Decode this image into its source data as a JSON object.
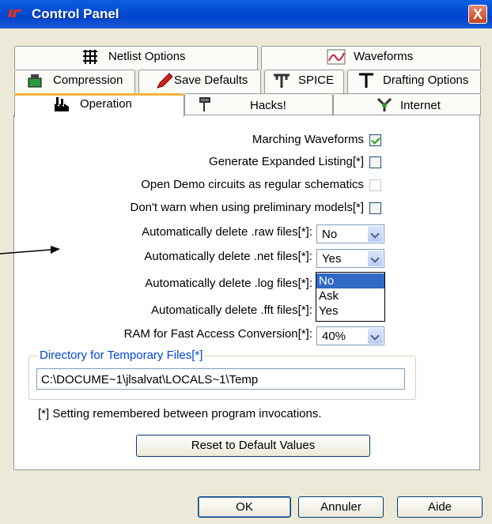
{
  "window": {
    "title": "Control Panel",
    "close": "X"
  },
  "tabs": {
    "row1": [
      {
        "label": "Netlist Options",
        "icon": "grid-icon"
      },
      {
        "label": "Waveforms",
        "icon": "waveform-icon"
      }
    ],
    "row2": [
      {
        "label": "Compression",
        "icon": "compression-icon"
      },
      {
        "label": "Save Defaults",
        "icon": "pencil-icon"
      },
      {
        "label": "SPICE",
        "icon": "spice-icon"
      },
      {
        "label": "Drafting Options",
        "icon": "drafting-icon"
      }
    ],
    "row3": [
      {
        "label": "Operation",
        "icon": "factory-icon",
        "active": true
      },
      {
        "label": "Hacks!",
        "icon": "hammer-icon"
      },
      {
        "label": "Internet",
        "icon": "network-icon"
      }
    ]
  },
  "options": {
    "checkboxes": [
      {
        "label": "Marching Waveforms",
        "checked": true
      },
      {
        "label": "Generate Expanded Listing[*]",
        "checked": false
      },
      {
        "label": "Open Demo circuits as regular schematics",
        "checked": false,
        "disabled": true
      },
      {
        "label": "Don't warn when using preliminary models[*]",
        "checked": false
      }
    ],
    "selects": [
      {
        "label": "Automatically delete .raw files[*]:",
        "value": "No"
      },
      {
        "label": "Automatically delete .net files[*]:",
        "value": "Yes"
      },
      {
        "label": "Automatically delete .log files[*]:",
        "value": ""
      },
      {
        "label": "Automatically delete .fft files[*]:",
        "value": ""
      },
      {
        "label": "RAM for Fast Access Conversion[*]:",
        "value": "40%"
      }
    ],
    "dropdown_open": {
      "items": [
        "No",
        "Ask",
        "Yes"
      ],
      "highlighted": "No"
    }
  },
  "temp_dir": {
    "group_title": "Directory for Temporary Files[*]",
    "value": "C:\\DOCUME~1\\jlsalvat\\LOCALS~1\\Temp"
  },
  "footnote": "[*] Setting remembered between program invocations.",
  "buttons": {
    "reset": "Reset to Default Values",
    "ok": "OK",
    "cancel": "Annuler",
    "help": "Aide"
  },
  "colors": {
    "titlebar": "#0a5fe0",
    "accent_tab": "#f5b43c",
    "selection": "#316ac5",
    "group_title": "#0046d5"
  }
}
